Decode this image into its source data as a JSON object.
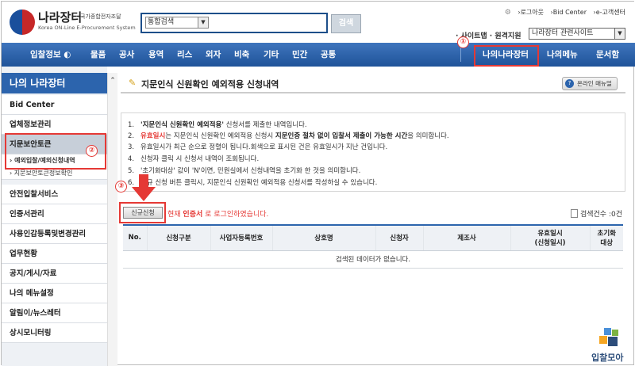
{
  "header": {
    "logo_title": "나라장터",
    "logo_sub1": "국가종합전자조달",
    "logo_sub2": "Korea ON-Line E-Procurement System",
    "search_select": "통합검색",
    "search_button": "검색",
    "top_links": [
      "로그아웃",
      "Bid Center",
      "e-고객센터"
    ],
    "sitemap": "· 사이트맵 · 원격지원",
    "related_select": "나라장터 관련사이트"
  },
  "nav": {
    "items": [
      "입찰정보",
      "물품",
      "공사",
      "용역",
      "리스",
      "외자",
      "비축",
      "기타",
      "민간",
      "공통"
    ],
    "right_items": [
      "나의나라장터",
      "나의메뉴",
      "문서함"
    ]
  },
  "sidebar": {
    "title": "나의 나라장터",
    "items": [
      "Bid Center",
      "업체정보관리",
      "지문보안토큰"
    ],
    "sub_items": [
      "예외입찰/예외신청내역",
      "지문보안토큰정보확인"
    ],
    "items2": [
      "안전입찰서비스",
      "인증서관리",
      "사용인감등록및변경관리",
      "업무현황",
      "공지/게시/자료",
      "나의 메뉴설정",
      "알림이/뉴스레터",
      "상시모니터링"
    ]
  },
  "main": {
    "title": "지문인식 신원확인 예외적용 신청내역",
    "help_button": "온라인 매뉴얼",
    "notes": [
      {
        "num": "1.",
        "text_bold": "'지문인식 신원확인 예외적용'",
        "text": " 신청서를 제출한 내역입니다."
      },
      {
        "num": "2.",
        "red": "유효일시",
        "text": "는 지문인식 신원확인 예외적용 신청시 ",
        "text_bold": "지문인증 절차 없이 입찰서 제출이 가능한 시간",
        "text2": "을 의미합니다."
      },
      {
        "num": "3.",
        "text": "유효일시가 최근 순으로 정렬이 됩니다.회색으로 표시된 건은 유효일시가 지난 건입니다."
      },
      {
        "num": "4.",
        "text": "신청자 클릭 시 신청서 내역이 조회됩니다."
      },
      {
        "num": "5.",
        "text": "'초기화대상' 값이 'N'이면, 민원실에서 신청내역을 초기화 한 것을 의미합니다."
      },
      {
        "num": "6.",
        "text": "신규 신청 버튼 클릭시, 지문인식 신원확인 예외적용 신청서를 작성하실 수 있습니다."
      }
    ],
    "new_button": "신규신청",
    "login_prefix": "현재 ",
    "login_bold": "인증서",
    "login_suffix": " 로 로그인하였습니다.",
    "count": "검색건수 :0건",
    "table": {
      "headers": [
        "No.",
        "신청구분",
        "사업자등록번호",
        "상호명",
        "신청자",
        "제조사",
        "유효일시\n(신청일시)",
        "초기화\n대상"
      ],
      "empty": "검색된 데이터가 없습니다."
    }
  },
  "annotations": [
    "①",
    "②",
    "③"
  ],
  "watermark": "입찰모아",
  "colors": {
    "accent": "#2c64ad",
    "annotation": "#e53935"
  }
}
